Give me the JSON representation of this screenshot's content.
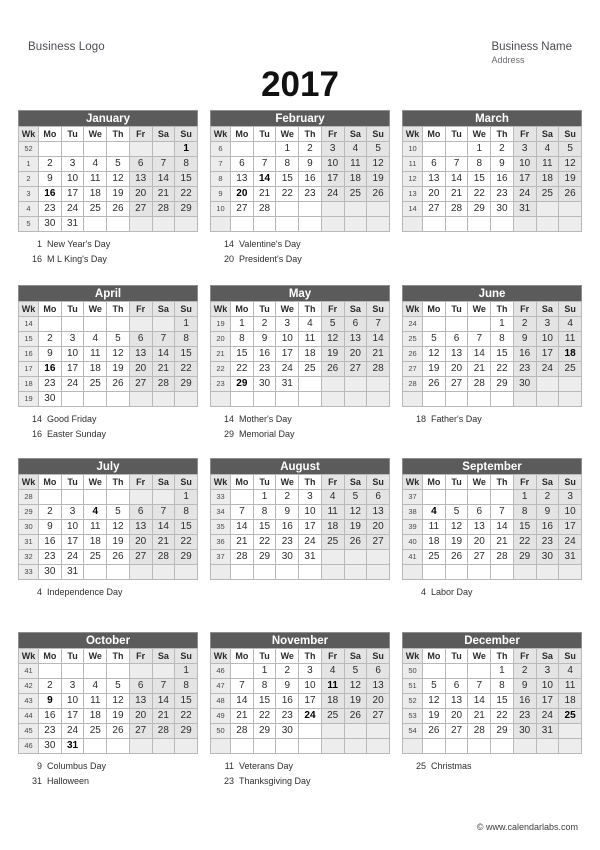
{
  "header": {
    "business_logo": "Business Logo",
    "business_name": "Business Name",
    "business_address": "Address",
    "year": "2017"
  },
  "weekday_headers": [
    "Wk",
    "Mo",
    "Tu",
    "We",
    "Th",
    "Fr",
    "Sa",
    "Su"
  ],
  "footer": {
    "copyright": "© www.calendarlabs.com"
  },
  "months": [
    {
      "name": "January",
      "weeks": [
        {
          "wk": "52",
          "days": [
            "",
            "",
            "",
            "",
            "",
            "",
            "1"
          ]
        },
        {
          "wk": "1",
          "days": [
            "2",
            "3",
            "4",
            "5",
            "6",
            "7",
            "8"
          ]
        },
        {
          "wk": "2",
          "days": [
            "9",
            "10",
            "11",
            "12",
            "13",
            "14",
            "15"
          ]
        },
        {
          "wk": "3",
          "days": [
            "16",
            "17",
            "18",
            "19",
            "20",
            "21",
            "22"
          ]
        },
        {
          "wk": "4",
          "days": [
            "23",
            "24",
            "25",
            "26",
            "27",
            "28",
            "29"
          ]
        },
        {
          "wk": "5",
          "days": [
            "30",
            "31",
            "",
            "",
            "",
            "",
            ""
          ]
        }
      ],
      "highlight": [
        "1",
        "16"
      ],
      "holidays": [
        {
          "date": "1",
          "name": "New Year's Day"
        },
        {
          "date": "16",
          "name": "M L King's Day"
        }
      ]
    },
    {
      "name": "February",
      "weeks": [
        {
          "wk": "6",
          "days": [
            "",
            "",
            "1",
            "2",
            "3",
            "4",
            "5"
          ]
        },
        {
          "wk": "7",
          "days": [
            "6",
            "7",
            "8",
            "9",
            "10",
            "11",
            "12"
          ]
        },
        {
          "wk": "8",
          "days": [
            "13",
            "14",
            "15",
            "16",
            "17",
            "18",
            "19"
          ]
        },
        {
          "wk": "9",
          "days": [
            "20",
            "21",
            "22",
            "23",
            "24",
            "25",
            "26"
          ]
        },
        {
          "wk": "10",
          "days": [
            "27",
            "28",
            "",
            "",
            "",
            "",
            ""
          ]
        },
        {
          "wk": "",
          "days": [
            "",
            "",
            "",
            "",
            "",
            "",
            ""
          ]
        }
      ],
      "highlight": [
        "14",
        "20"
      ],
      "holidays": [
        {
          "date": "14",
          "name": "Valentine's Day"
        },
        {
          "date": "20",
          "name": "President's Day"
        }
      ]
    },
    {
      "name": "March",
      "weeks": [
        {
          "wk": "10",
          "days": [
            "",
            "",
            "1",
            "2",
            "3",
            "4",
            "5"
          ]
        },
        {
          "wk": "11",
          "days": [
            "6",
            "7",
            "8",
            "9",
            "10",
            "11",
            "12"
          ]
        },
        {
          "wk": "12",
          "days": [
            "13",
            "14",
            "15",
            "16",
            "17",
            "18",
            "19"
          ]
        },
        {
          "wk": "13",
          "days": [
            "20",
            "21",
            "22",
            "23",
            "24",
            "25",
            "26"
          ]
        },
        {
          "wk": "14",
          "days": [
            "27",
            "28",
            "29",
            "30",
            "31",
            "",
            ""
          ]
        },
        {
          "wk": "",
          "days": [
            "",
            "",
            "",
            "",
            "",
            "",
            ""
          ]
        }
      ],
      "highlight": [],
      "holidays": []
    },
    {
      "name": "April",
      "weeks": [
        {
          "wk": "14",
          "days": [
            "",
            "",
            "",
            "",
            "",
            "",
            "1"
          ]
        },
        {
          "wk": "15",
          "days": [
            "2",
            "3",
            "4",
            "5",
            "6",
            "7",
            "8"
          ]
        },
        {
          "wk": "16",
          "days": [
            "9",
            "10",
            "11",
            "12",
            "13",
            "14",
            "15"
          ]
        },
        {
          "wk": "17",
          "days": [
            "16",
            "17",
            "18",
            "19",
            "20",
            "21",
            "22"
          ]
        },
        {
          "wk": "18",
          "days": [
            "23",
            "24",
            "25",
            "26",
            "27",
            "28",
            "29"
          ]
        },
        {
          "wk": "19",
          "days": [
            "30",
            "",
            "",
            "",
            "",
            "",
            ""
          ]
        }
      ],
      "highlight": [
        "16"
      ],
      "holidays": [
        {
          "date": "14",
          "name": "Good Friday"
        },
        {
          "date": "16",
          "name": "Easter Sunday"
        }
      ]
    },
    {
      "name": "May",
      "weeks": [
        {
          "wk": "19",
          "days": [
            "1",
            "2",
            "3",
            "4",
            "5",
            "6",
            "7"
          ]
        },
        {
          "wk": "20",
          "days": [
            "8",
            "9",
            "10",
            "11",
            "12",
            "13",
            "14"
          ]
        },
        {
          "wk": "21",
          "days": [
            "15",
            "16",
            "17",
            "18",
            "19",
            "20",
            "21"
          ]
        },
        {
          "wk": "22",
          "days": [
            "22",
            "23",
            "24",
            "25",
            "26",
            "27",
            "28"
          ]
        },
        {
          "wk": "23",
          "days": [
            "29",
            "30",
            "31",
            "",
            "",
            "",
            ""
          ]
        },
        {
          "wk": "",
          "days": [
            "",
            "",
            "",
            "",
            "",
            "",
            ""
          ]
        }
      ],
      "highlight": [
        "29"
      ],
      "holidays": [
        {
          "date": "14",
          "name": "Mother's Day"
        },
        {
          "date": "29",
          "name": "Memorial Day"
        }
      ]
    },
    {
      "name": "June",
      "weeks": [
        {
          "wk": "24",
          "days": [
            "",
            "",
            "",
            "1",
            "2",
            "3",
            "4"
          ]
        },
        {
          "wk": "25",
          "days": [
            "5",
            "6",
            "7",
            "8",
            "9",
            "10",
            "11"
          ]
        },
        {
          "wk": "26",
          "days": [
            "12",
            "13",
            "14",
            "15",
            "16",
            "17",
            "18"
          ]
        },
        {
          "wk": "27",
          "days": [
            "19",
            "20",
            "21",
            "22",
            "23",
            "24",
            "25"
          ]
        },
        {
          "wk": "28",
          "days": [
            "26",
            "27",
            "28",
            "29",
            "30",
            "",
            ""
          ]
        },
        {
          "wk": "",
          "days": [
            "",
            "",
            "",
            "",
            "",
            "",
            ""
          ]
        }
      ],
      "highlight": [
        "18"
      ],
      "holidays": [
        {
          "date": "18",
          "name": "Father's Day"
        }
      ]
    },
    {
      "name": "July",
      "weeks": [
        {
          "wk": "28",
          "days": [
            "",
            "",
            "",
            "",
            "",
            "",
            "1"
          ]
        },
        {
          "wk": "29",
          "days": [
            "2",
            "3",
            "4",
            "5",
            "6",
            "7",
            "8"
          ]
        },
        {
          "wk": "30",
          "days": [
            "9",
            "10",
            "11",
            "12",
            "13",
            "14",
            "15"
          ]
        },
        {
          "wk": "31",
          "days": [
            "16",
            "17",
            "18",
            "19",
            "20",
            "21",
            "22"
          ]
        },
        {
          "wk": "32",
          "days": [
            "23",
            "24",
            "25",
            "26",
            "27",
            "28",
            "29"
          ]
        },
        {
          "wk": "33",
          "days": [
            "30",
            "31",
            "",
            "",
            "",
            "",
            ""
          ]
        }
      ],
      "highlight": [
        "4"
      ],
      "holidays": [
        {
          "date": "4",
          "name": "Independence Day"
        }
      ]
    },
    {
      "name": "August",
      "weeks": [
        {
          "wk": "33",
          "days": [
            "",
            "1",
            "2",
            "3",
            "4",
            "5",
            "6"
          ]
        },
        {
          "wk": "34",
          "days": [
            "7",
            "8",
            "9",
            "10",
            "11",
            "12",
            "13"
          ]
        },
        {
          "wk": "35",
          "days": [
            "14",
            "15",
            "16",
            "17",
            "18",
            "19",
            "20"
          ]
        },
        {
          "wk": "36",
          "days": [
            "21",
            "22",
            "23",
            "24",
            "25",
            "26",
            "27"
          ]
        },
        {
          "wk": "37",
          "days": [
            "28",
            "29",
            "30",
            "31",
            "",
            "",
            ""
          ]
        },
        {
          "wk": "",
          "days": [
            "",
            "",
            "",
            "",
            "",
            "",
            ""
          ]
        }
      ],
      "highlight": [],
      "holidays": []
    },
    {
      "name": "September",
      "weeks": [
        {
          "wk": "37",
          "days": [
            "",
            "",
            "",
            "",
            "1",
            "2",
            "3"
          ]
        },
        {
          "wk": "38",
          "days": [
            "4",
            "5",
            "6",
            "7",
            "8",
            "9",
            "10"
          ]
        },
        {
          "wk": "39",
          "days": [
            "11",
            "12",
            "13",
            "14",
            "15",
            "16",
            "17"
          ]
        },
        {
          "wk": "40",
          "days": [
            "18",
            "19",
            "20",
            "21",
            "22",
            "23",
            "24"
          ]
        },
        {
          "wk": "41",
          "days": [
            "25",
            "26",
            "27",
            "28",
            "29",
            "30",
            "31"
          ]
        },
        {
          "wk": "",
          "days": [
            "",
            "",
            "",
            "",
            "",
            "",
            ""
          ]
        }
      ],
      "highlight": [
        "4"
      ],
      "holidays": [
        {
          "date": "4",
          "name": "Labor Day"
        }
      ]
    },
    {
      "name": "October",
      "weeks": [
        {
          "wk": "41",
          "days": [
            "",
            "",
            "",
            "",
            "",
            "",
            "1"
          ]
        },
        {
          "wk": "42",
          "days": [
            "2",
            "3",
            "4",
            "5",
            "6",
            "7",
            "8"
          ]
        },
        {
          "wk": "43",
          "days": [
            "9",
            "10",
            "11",
            "12",
            "13",
            "14",
            "15"
          ]
        },
        {
          "wk": "44",
          "days": [
            "16",
            "17",
            "18",
            "19",
            "20",
            "21",
            "22"
          ]
        },
        {
          "wk": "45",
          "days": [
            "23",
            "24",
            "25",
            "26",
            "27",
            "28",
            "29"
          ]
        },
        {
          "wk": "46",
          "days": [
            "30",
            "31",
            "",
            "",
            "",
            "",
            ""
          ]
        }
      ],
      "highlight": [
        "9",
        "31"
      ],
      "holidays": [
        {
          "date": "9",
          "name": "Columbus Day"
        },
        {
          "date": "31",
          "name": "Halloween"
        }
      ]
    },
    {
      "name": "November",
      "weeks": [
        {
          "wk": "46",
          "days": [
            "",
            "1",
            "2",
            "3",
            "4",
            "5",
            "6"
          ]
        },
        {
          "wk": "47",
          "days": [
            "7",
            "8",
            "9",
            "10",
            "11",
            "12",
            "13"
          ]
        },
        {
          "wk": "48",
          "days": [
            "14",
            "15",
            "16",
            "17",
            "18",
            "19",
            "20"
          ]
        },
        {
          "wk": "49",
          "days": [
            "21",
            "22",
            "23",
            "24",
            "25",
            "26",
            "27"
          ]
        },
        {
          "wk": "50",
          "days": [
            "28",
            "29",
            "30",
            "",
            "",
            "",
            ""
          ]
        },
        {
          "wk": "",
          "days": [
            "",
            "",
            "",
            "",
            "",
            "",
            ""
          ]
        }
      ],
      "highlight": [
        "11",
        "24"
      ],
      "holidays": [
        {
          "date": "11",
          "name": "Veterans Day"
        },
        {
          "date": "23",
          "name": "Thanksgiving Day"
        }
      ]
    },
    {
      "name": "December",
      "weeks": [
        {
          "wk": "50",
          "days": [
            "",
            "",
            "",
            "1",
            "2",
            "3",
            "4"
          ]
        },
        {
          "wk": "51",
          "days": [
            "5",
            "6",
            "7",
            "8",
            "9",
            "10",
            "11"
          ]
        },
        {
          "wk": "52",
          "days": [
            "12",
            "13",
            "14",
            "15",
            "16",
            "17",
            "18"
          ]
        },
        {
          "wk": "53",
          "days": [
            "19",
            "20",
            "21",
            "22",
            "23",
            "24",
            "25"
          ]
        },
        {
          "wk": "54",
          "days": [
            "26",
            "27",
            "28",
            "29",
            "30",
            "31",
            ""
          ]
        },
        {
          "wk": "",
          "days": [
            "",
            "",
            "",
            "",
            "",
            "",
            ""
          ]
        }
      ],
      "highlight": [
        "25"
      ],
      "holidays": [
        {
          "date": "25",
          "name": "Christmas"
        }
      ]
    }
  ]
}
